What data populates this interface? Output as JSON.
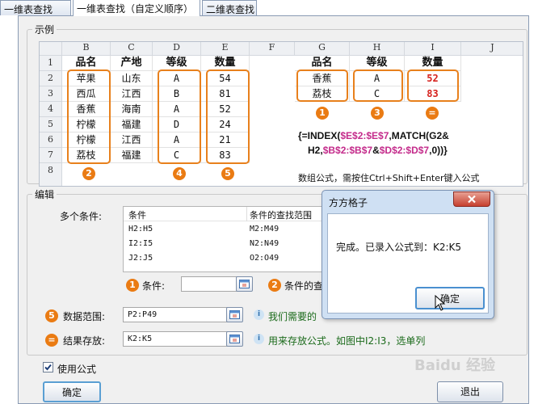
{
  "tabs": [
    "一维表查找",
    "一维表查找（自定义顺序）",
    "二维表查找"
  ],
  "example": {
    "title": "示例",
    "col_headers": [
      "B",
      "C",
      "D",
      "E",
      "F",
      "G",
      "H",
      "I",
      "J"
    ],
    "row_numbers": [
      "1",
      "2",
      "3",
      "4",
      "5",
      "6",
      "7",
      "8"
    ],
    "left_header": [
      "品名",
      "产地",
      "等级",
      "数量"
    ],
    "left_rows": [
      [
        "苹果",
        "山东",
        "A",
        "54"
      ],
      [
        "西瓜",
        "江西",
        "B",
        "81"
      ],
      [
        "香蕉",
        "海南",
        "A",
        "52"
      ],
      [
        "柠檬",
        "福建",
        "D",
        "24"
      ],
      [
        "柠檬",
        "江西",
        "A",
        "21"
      ],
      [
        "荔枝",
        "福建",
        "C",
        "83"
      ]
    ],
    "right_header": [
      "品名",
      "等级",
      "数量"
    ],
    "right_rows": [
      [
        "香蕉",
        "A",
        "52"
      ],
      [
        "荔枝",
        "C",
        "83"
      ]
    ],
    "badges": {
      "b1": "1",
      "b2": "2",
      "b3": "3",
      "b4": "4",
      "b5": "5",
      "beq": "="
    },
    "formula": {
      "l1a": "{=INDEX(",
      "l1b": "$E$2:$E$7",
      "l1c": ",MATCH(G2&",
      "l2a": "H2,",
      "l2b": "$B$2:$B$7",
      "l2c": "&",
      "l2d": "$D$2:$D$7",
      "l2e": ",0))}"
    },
    "note": "数组公式，需按住Ctrl+Shift+Enter键入公式"
  },
  "edit": {
    "title": "编辑",
    "multi_label": "多个条件:",
    "table_headers": [
      "条件",
      "条件的查找范围"
    ],
    "table_rows": [
      [
        "H2:H5",
        "M2:M49"
      ],
      [
        "I2:I5",
        "N2:N49"
      ],
      [
        "J2:J5",
        "O2:O49"
      ]
    ],
    "cond_label": "条件:",
    "cond_range_label": "条件的查",
    "data_range_label": "数据范围:",
    "data_range_value": "P2:P49",
    "data_range_hint": "我们需要的",
    "result_label": "结果存放:",
    "result_value": "K2:K5",
    "result_hint": "用来存放公式。如图中I2:I3，选单列"
  },
  "use_formula_label": "使用公式",
  "ok_label": "确定",
  "exit_label": "退出",
  "dialog": {
    "title": "方方格子",
    "message": "完成。已录入公式到：K2:K5",
    "ok_label": "确定"
  },
  "watermark": "Baidu 经验"
}
